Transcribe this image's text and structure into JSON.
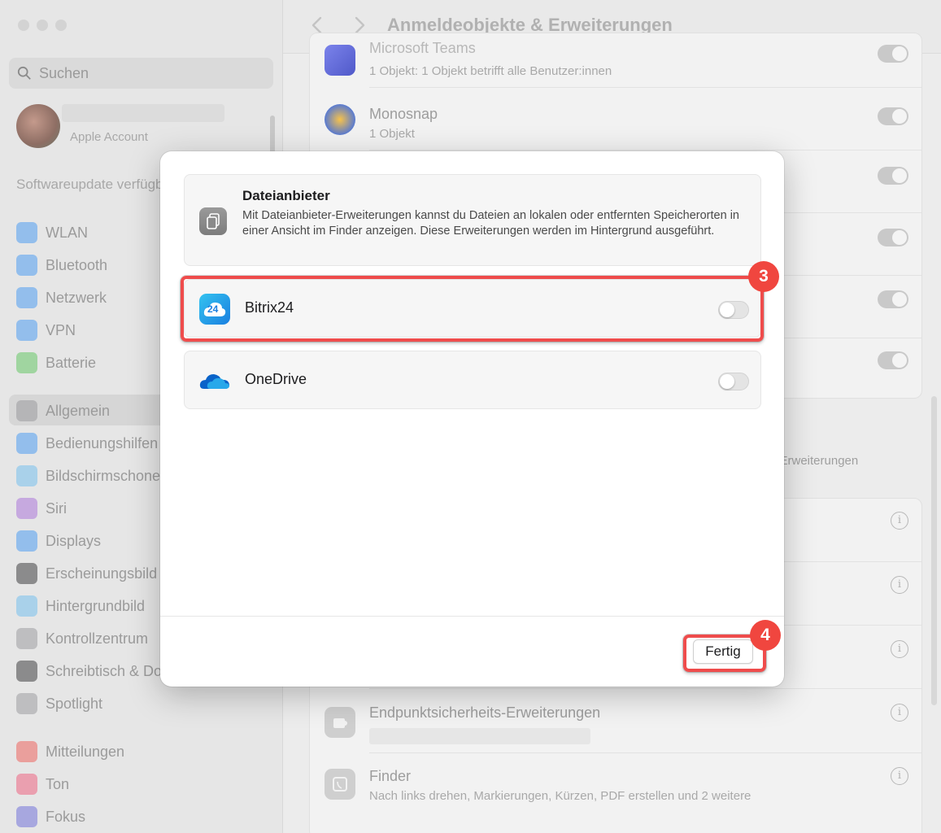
{
  "sidebar": {
    "search_placeholder": "Suchen",
    "account_sub": "Apple Account",
    "software_update": "Softwareupdate verfügbar",
    "items": [
      {
        "label": "WLAN",
        "icon": "wifi-icon",
        "color": "#2f8ff5"
      },
      {
        "label": "Bluetooth",
        "icon": "bluetooth-icon",
        "color": "#2f8ff5"
      },
      {
        "label": "Netzwerk",
        "icon": "globe-icon",
        "color": "#2f8ff5"
      },
      {
        "label": "VPN",
        "icon": "vpn-icon",
        "color": "#2f8ff5"
      },
      {
        "label": "Batterie",
        "icon": "battery-icon",
        "color": "#4cc24b"
      },
      {
        "label": "Allgemein",
        "icon": "gear-icon",
        "color": "#8e8e93"
      },
      {
        "label": "Bedienungshilfen",
        "icon": "accessibility-icon",
        "color": "#2f8ff5"
      },
      {
        "label": "Bildschirmschoner",
        "icon": "screensaver-icon",
        "color": "#5fb8ef"
      },
      {
        "label": "Siri",
        "icon": "siri-icon",
        "color": "#a05fd8"
      },
      {
        "label": "Displays",
        "icon": "sun-icon",
        "color": "#2f8ff5"
      },
      {
        "label": "Erscheinungsbild",
        "icon": "appearance-icon",
        "color": "#1d1d1f"
      },
      {
        "label": "Hintergrundbild",
        "icon": "flower-icon",
        "color": "#5fb8ef"
      },
      {
        "label": "Kontrollzentrum",
        "icon": "toggles-icon",
        "color": "#8e8e93"
      },
      {
        "label": "Schreibtisch & Dock",
        "icon": "dock-icon",
        "color": "#1d1d1f"
      },
      {
        "label": "Spotlight",
        "icon": "spotlight-icon",
        "color": "#8e8e93"
      },
      {
        "label": "Mitteilungen",
        "icon": "bell-icon",
        "color": "#f04a43"
      },
      {
        "label": "Ton",
        "icon": "speaker-icon",
        "color": "#f04a6d"
      },
      {
        "label": "Fokus",
        "icon": "moon-icon",
        "color": "#5b5bd6"
      }
    ]
  },
  "main": {
    "title": "Anmeldeobjekte & Erweiterungen",
    "rows_top": [
      {
        "title": "Microsoft Teams",
        "sub": "1 Objekt: 1 Objekt betrifft alle Benutzer:innen"
      },
      {
        "title": "Monosnap",
        "sub": "1 Objekt"
      }
    ],
    "extensions_text": "e Erweiterungen",
    "rows_bottom": [
      {
        "title": "Endpunktsicherheits-Erweiterungen",
        "sub": ""
      },
      {
        "title": "Finder",
        "sub": "Nach links drehen, Markierungen, Kürzen, PDF erstellen und 2 weitere"
      }
    ]
  },
  "modal": {
    "title": "Dateianbieter",
    "description": "Mit Dateianbieter-Erweiterungen kannst du Dateien an lokalen oder entfernten Speicherorten in einer Ansicht im Finder anzeigen. Diese Erweiterungen werden im Hintergrund ausgeführt.",
    "providers": [
      {
        "name": "Bitrix24",
        "enabled": false,
        "logo_text": "24"
      },
      {
        "name": "OneDrive",
        "enabled": false
      }
    ],
    "done_label": "Fertig"
  },
  "annotations": {
    "step3": "3",
    "step4": "4",
    "color": "#ef4c4c"
  }
}
